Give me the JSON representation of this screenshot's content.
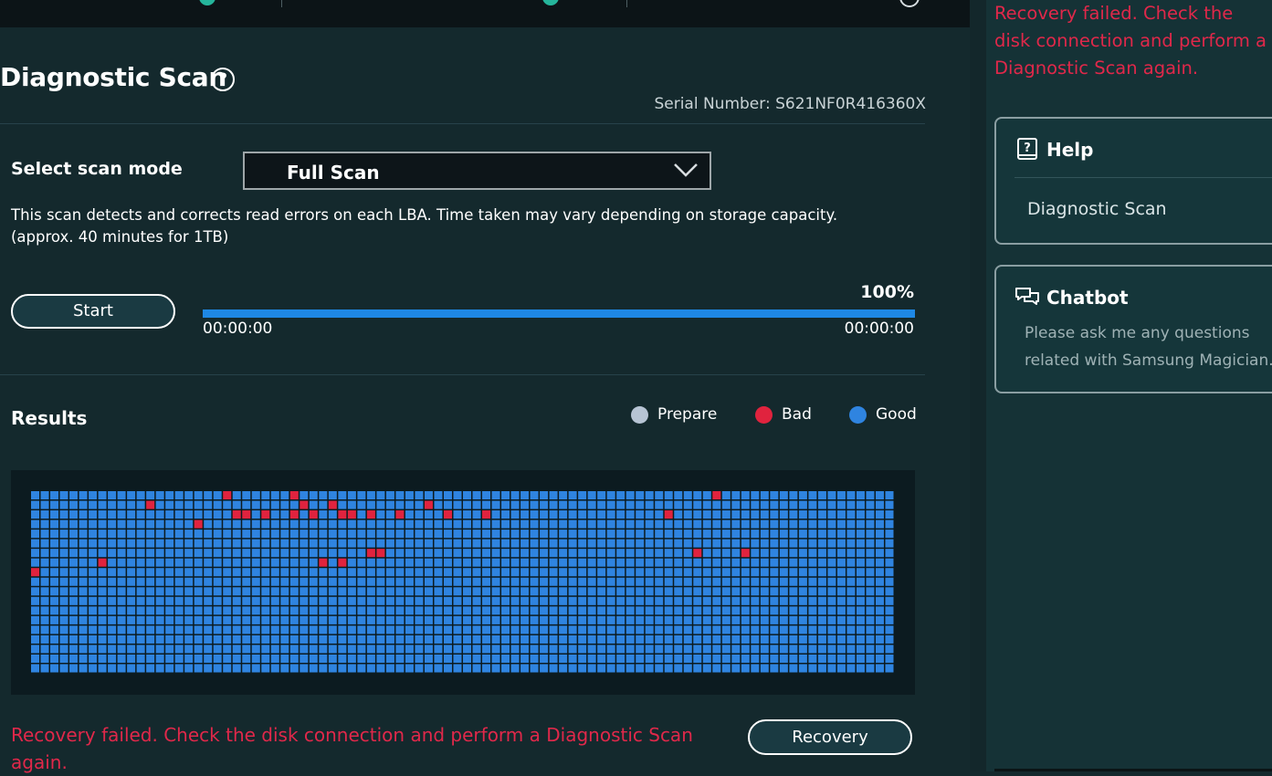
{
  "header": {
    "title": "Diagnostic Scan",
    "help_glyph": "?",
    "serial_number": "Serial Number: S621NF0R416360X"
  },
  "scan_mode": {
    "label": "Select scan mode",
    "selected": "Full Scan",
    "description_line1": "This scan detects and corrects read errors on each LBA. Time taken may vary depending on storage capacity.",
    "description_line2": "(approx. 40 minutes for 1TB)"
  },
  "controls": {
    "start_label": "Start",
    "progress_text": "100%",
    "progress_value": 100,
    "elapsed": "00:00:00",
    "remaining": "00:00:00"
  },
  "results": {
    "label": "Results",
    "legend": [
      {
        "name": "Prepare",
        "color": "#b7c4d4"
      },
      {
        "name": "Bad",
        "color": "#e0233e"
      },
      {
        "name": "Good",
        "color": "#2f84e0"
      }
    ],
    "grid_columns": 90,
    "grid_rows": 19,
    "bad_cells": [
      [
        0,
        20
      ],
      [
        0,
        27
      ],
      [
        0,
        71
      ],
      [
        1,
        12
      ],
      [
        1,
        28
      ],
      [
        1,
        31
      ],
      [
        1,
        41
      ],
      [
        2,
        21
      ],
      [
        2,
        22
      ],
      [
        2,
        24
      ],
      [
        2,
        27
      ],
      [
        2,
        29
      ],
      [
        2,
        32
      ],
      [
        2,
        33
      ],
      [
        2,
        35
      ],
      [
        2,
        38
      ],
      [
        2,
        43
      ],
      [
        2,
        47
      ],
      [
        2,
        66
      ],
      [
        3,
        17
      ],
      [
        6,
        35
      ],
      [
        6,
        36
      ],
      [
        6,
        69
      ],
      [
        6,
        74
      ],
      [
        7,
        7
      ],
      [
        7,
        30
      ],
      [
        7,
        32
      ],
      [
        8,
        0
      ]
    ]
  },
  "status": {
    "error_message": "Recovery failed. Check the disk connection and perform a Diagnostic Scan again.",
    "recovery_label": "Recovery"
  },
  "sidebar": {
    "error_message": "Recovery failed. Check the disk connection and perform a Diagnostic Scan again.",
    "help": {
      "title": "Help",
      "link": "Diagnostic Scan",
      "icon": "help-book-icon"
    },
    "chatbot": {
      "title": "Chatbot",
      "text": "Please ask me any questions related with Samsung Magician.",
      "icon": "chat-bubbles-icon"
    }
  },
  "colors": {
    "background": "#14292d",
    "accent": "#1e88e5",
    "error": "#e0284a",
    "good": "#2f84e0",
    "bad": "#e0233e"
  }
}
